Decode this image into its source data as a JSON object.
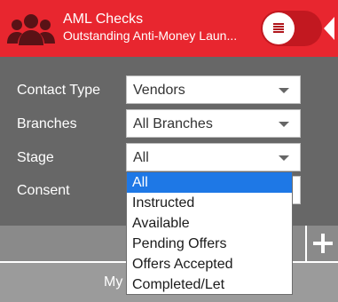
{
  "header": {
    "title": "AML Checks",
    "subtitle": "Outstanding Anti-Money Laun...",
    "brand_color": "#e8262f"
  },
  "filters": [
    {
      "label": "Contact Type",
      "value": "Vendors"
    },
    {
      "label": "Branches",
      "value": "All Branches"
    },
    {
      "label": "Stage",
      "value": "All"
    },
    {
      "label": "Consent",
      "value": ""
    }
  ],
  "dropdown": {
    "options": [
      "All",
      "Instructed",
      "Available",
      "Pending Offers",
      "Offers Accepted",
      "Completed/Let"
    ],
    "selected": "All",
    "highlight_color": "#1e78e6"
  },
  "footer": {
    "text": "My"
  }
}
